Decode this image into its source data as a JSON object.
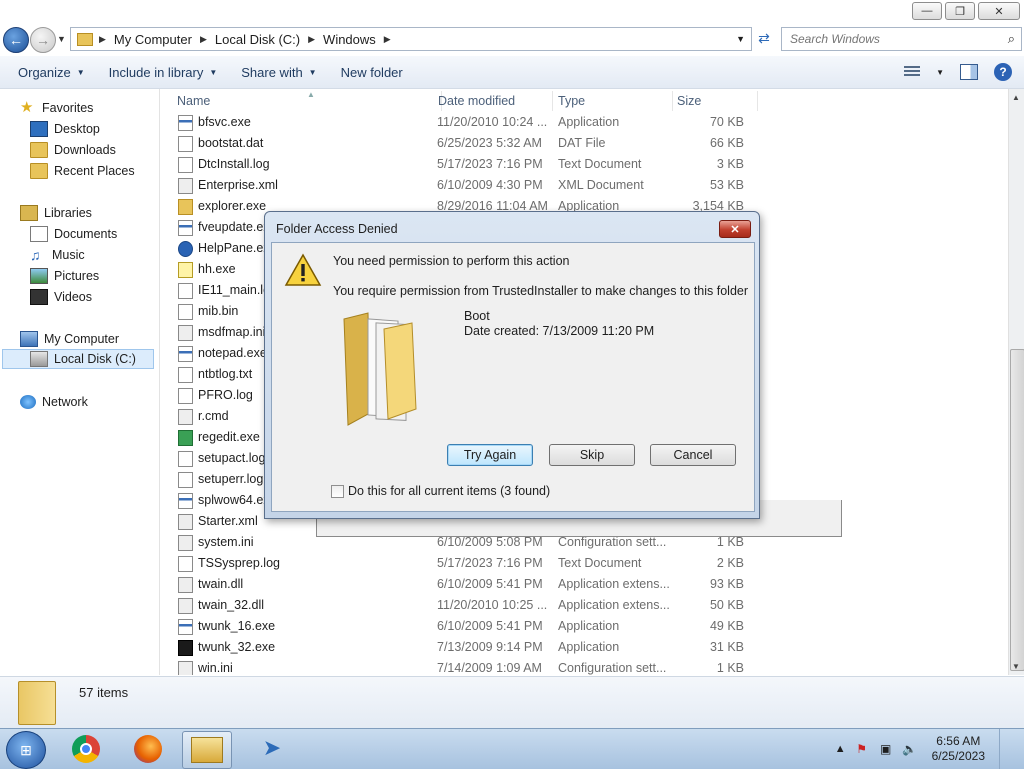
{
  "address": {
    "crumbs": [
      "My Computer",
      "Local Disk (C:)",
      "Windows"
    ],
    "search_placeholder": "Search Windows"
  },
  "toolbar": {
    "organize": "Organize",
    "include_in_library": "Include in library",
    "share_with": "Share with",
    "new_folder": "New folder"
  },
  "nav": {
    "favorites": "Favorites",
    "desktop": "Desktop",
    "downloads": "Downloads",
    "recent_places": "Recent Places",
    "libraries": "Libraries",
    "documents": "Documents",
    "music": "Music",
    "pictures": "Pictures",
    "videos": "Videos",
    "my_computer": "My Computer",
    "local_disk": "Local Disk (C:)",
    "network": "Network"
  },
  "columns": {
    "name": "Name",
    "date": "Date modified",
    "type": "Type",
    "size": "Size"
  },
  "files": [
    {
      "name": "bfsvc.exe",
      "date": "11/20/2010 10:24 ...",
      "type": "Application",
      "size": "70 KB",
      "icon": "app-icon"
    },
    {
      "name": "bootstat.dat",
      "date": "6/25/2023 5:32 AM",
      "type": "DAT File",
      "size": "66 KB",
      "icon": "file-icon"
    },
    {
      "name": "DtcInstall.log",
      "date": "5/17/2023 7:16 PM",
      "type": "Text Document",
      "size": "3 KB",
      "icon": "file-icon"
    },
    {
      "name": "Enterprise.xml",
      "date": "6/10/2009 4:30 PM",
      "type": "XML Document",
      "size": "53 KB",
      "icon": "xml-icon"
    },
    {
      "name": "explorer.exe",
      "date": "8/29/2016 11:04 AM",
      "type": "Application",
      "size": "3,154 KB",
      "icon": "folder-icon"
    },
    {
      "name": "fveupdate.exe",
      "date": "",
      "type": "",
      "size": "",
      "icon": "app-icon"
    },
    {
      "name": "HelpPane.exe",
      "date": "",
      "type": "",
      "size": "",
      "icon": "help-icon"
    },
    {
      "name": "hh.exe",
      "date": "",
      "type": "",
      "size": "",
      "icon": "question-icon"
    },
    {
      "name": "IE11_main.log",
      "date": "",
      "type": "",
      "size": "",
      "icon": "file-icon"
    },
    {
      "name": "mib.bin",
      "date": "",
      "type": "",
      "size": "",
      "icon": "file-icon"
    },
    {
      "name": "msdfmap.ini",
      "date": "",
      "type": "",
      "size": "",
      "icon": "settings-icon"
    },
    {
      "name": "notepad.exe",
      "date": "",
      "type": "",
      "size": "",
      "icon": "app-icon"
    },
    {
      "name": "ntbtlog.txt",
      "date": "",
      "type": "",
      "size": "",
      "icon": "file-icon"
    },
    {
      "name": "PFRO.log",
      "date": "",
      "type": "",
      "size": "",
      "icon": "file-icon"
    },
    {
      "name": "r.cmd",
      "date": "",
      "type": "",
      "size": "",
      "icon": "settings-icon"
    },
    {
      "name": "regedit.exe",
      "date": "",
      "type": "",
      "size": "",
      "icon": "regedit-icon"
    },
    {
      "name": "setupact.log",
      "date": "",
      "type": "",
      "size": "",
      "icon": "file-icon"
    },
    {
      "name": "setuperr.log",
      "date": "",
      "type": "",
      "size": "",
      "icon": "file-icon"
    },
    {
      "name": "splwow64.exe",
      "date": "",
      "type": "",
      "size": "",
      "icon": "app-icon"
    },
    {
      "name": "Starter.xml",
      "date": "",
      "type": "",
      "size": "KB",
      "icon": "xml-icon"
    },
    {
      "name": "system.ini",
      "date": "6/10/2009 5:08 PM",
      "type": "Configuration sett...",
      "size": "1 KB",
      "icon": "settings-icon"
    },
    {
      "name": "TSSysprep.log",
      "date": "5/17/2023 7:16 PM",
      "type": "Text Document",
      "size": "2 KB",
      "icon": "file-icon"
    },
    {
      "name": "twain.dll",
      "date": "6/10/2009 5:41 PM",
      "type": "Application extens...",
      "size": "93 KB",
      "icon": "settings-icon"
    },
    {
      "name": "twain_32.dll",
      "date": "11/20/2010 10:25 ...",
      "type": "Application extens...",
      "size": "50 KB",
      "icon": "settings-icon"
    },
    {
      "name": "twunk_16.exe",
      "date": "6/10/2009 5:41 PM",
      "type": "Application",
      "size": "49 KB",
      "icon": "app-icon"
    },
    {
      "name": "twunk_32.exe",
      "date": "7/13/2009 9:14 PM",
      "type": "Application",
      "size": "31 KB",
      "icon": "dark-app-icon"
    },
    {
      "name": "win.ini",
      "date": "7/14/2009 1:09 AM",
      "type": "Configuration sett...",
      "size": "1 KB",
      "icon": "settings-icon"
    }
  ],
  "status": {
    "item_count": "57 items"
  },
  "dialog": {
    "title": "Folder Access Denied",
    "message": "You need permission to perform this action",
    "detail": "You require permission from TrustedInstaller to make changes to this folder",
    "folder_name": "Boot",
    "date_created": "Date created: 7/13/2009 11:20 PM",
    "try_again": "Try Again",
    "skip": "Skip",
    "cancel": "Cancel",
    "apply_all": "Do this for all current items (3 found)"
  },
  "clock": {
    "time": "6:56 AM",
    "date": "6/25/2023"
  }
}
